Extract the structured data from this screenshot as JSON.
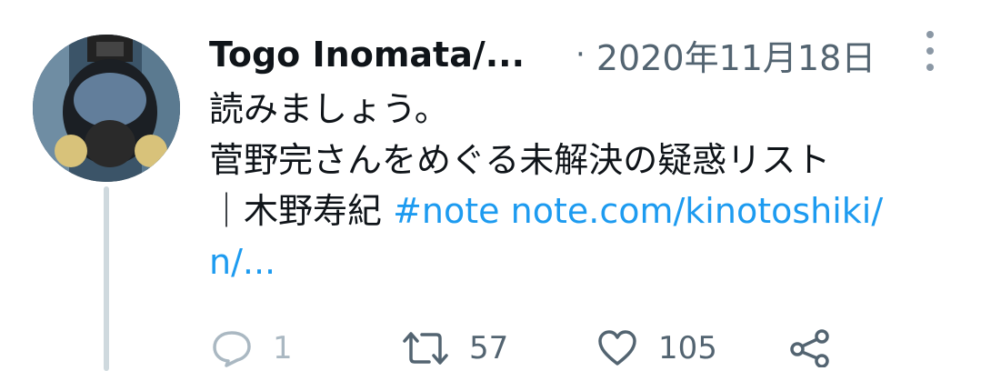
{
  "tweet": {
    "author": "Togo Inomata/...",
    "separator": "·",
    "date": "2020年11月18日",
    "text_line1": "読みましょう。",
    "text_line2": "菅野完さんをめぐる未解決の疑惑リスト",
    "text_line3_prefix": "｜木野寿紀 ",
    "hashtag": "#note",
    "link_part1": "note.com/kinotoshiki/",
    "link_part2": "n/..."
  },
  "actions": {
    "reply_count": "1",
    "retweet_count": "57",
    "like_count": "105"
  },
  "icons": {
    "avatar": "avatar-gas-mask-photo",
    "more": "more-vertical-icon",
    "reply": "reply-icon",
    "retweet": "retweet-icon",
    "like": "heart-icon",
    "share": "share-icon"
  },
  "colors": {
    "link": "#1d9bf0",
    "muted": "#536471",
    "thread_line": "#cfd9de"
  }
}
